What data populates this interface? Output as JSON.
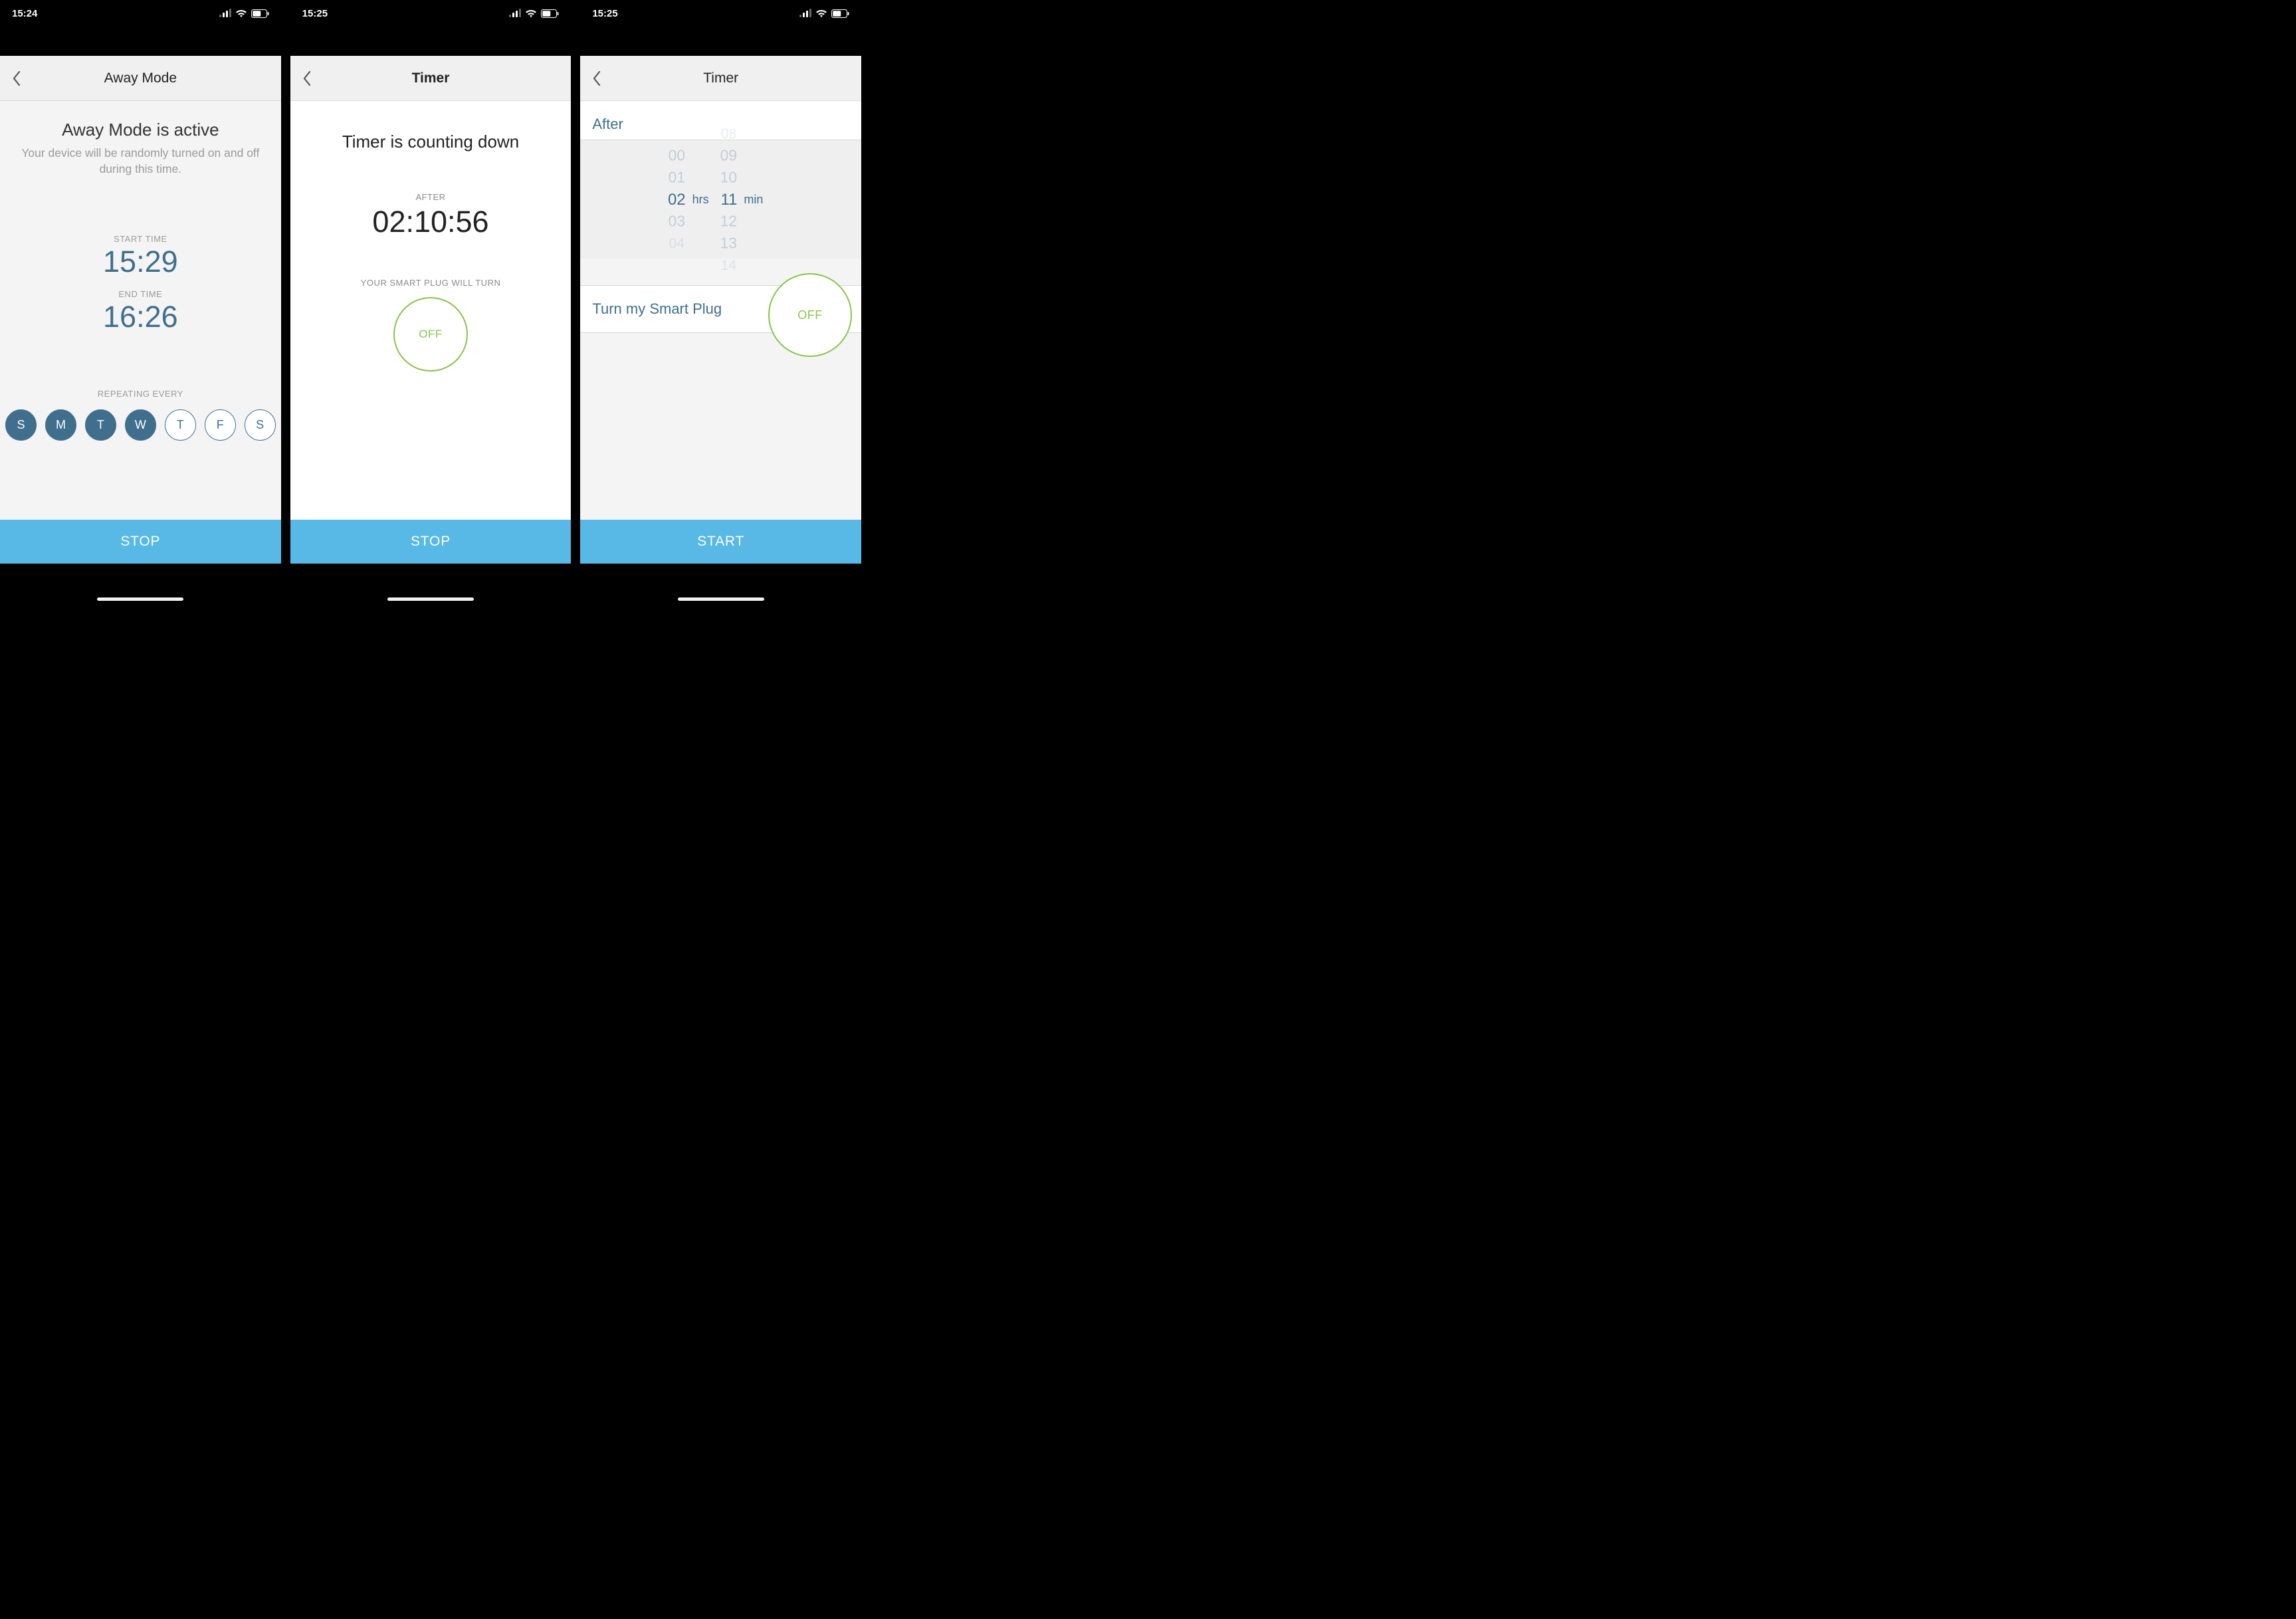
{
  "screens": [
    {
      "statusbar": {
        "time": "15:24"
      },
      "title": "Away Mode",
      "headline": "Away Mode is active",
      "subtitle": "Your device will be randomly turned on and off during this time.",
      "start": {
        "label": "START TIME",
        "value": "15:29"
      },
      "end": {
        "label": "END TIME",
        "value": "16:26"
      },
      "repeat_label": "REPEATING EVERY",
      "days": [
        {
          "abbr": "S",
          "selected": true
        },
        {
          "abbr": "M",
          "selected": true
        },
        {
          "abbr": "T",
          "selected": true
        },
        {
          "abbr": "W",
          "selected": true
        },
        {
          "abbr": "T",
          "selected": false
        },
        {
          "abbr": "F",
          "selected": false
        },
        {
          "abbr": "S",
          "selected": false
        }
      ],
      "action": "STOP"
    },
    {
      "statusbar": {
        "time": "15:25"
      },
      "title": "Timer",
      "headline": "Timer is counting down",
      "after_label": "AFTER",
      "countdown": "02:10:56",
      "turn_label": "YOUR SMART PLUG WILL TURN",
      "state": "OFF",
      "action": "STOP"
    },
    {
      "statusbar": {
        "time": "15:25"
      },
      "title": "Timer",
      "after_heading": "After",
      "picker": {
        "hours": {
          "values": [
            "00",
            "01",
            "02",
            "03",
            "04"
          ],
          "selected": "02",
          "unit": "hrs"
        },
        "minutes": {
          "values": [
            "08",
            "09",
            "10",
            "11",
            "12",
            "13",
            "14"
          ],
          "selected": "11",
          "unit": "min"
        }
      },
      "turn_row": "Turn my Smart Plug",
      "state": "OFF",
      "action": "START"
    }
  ]
}
